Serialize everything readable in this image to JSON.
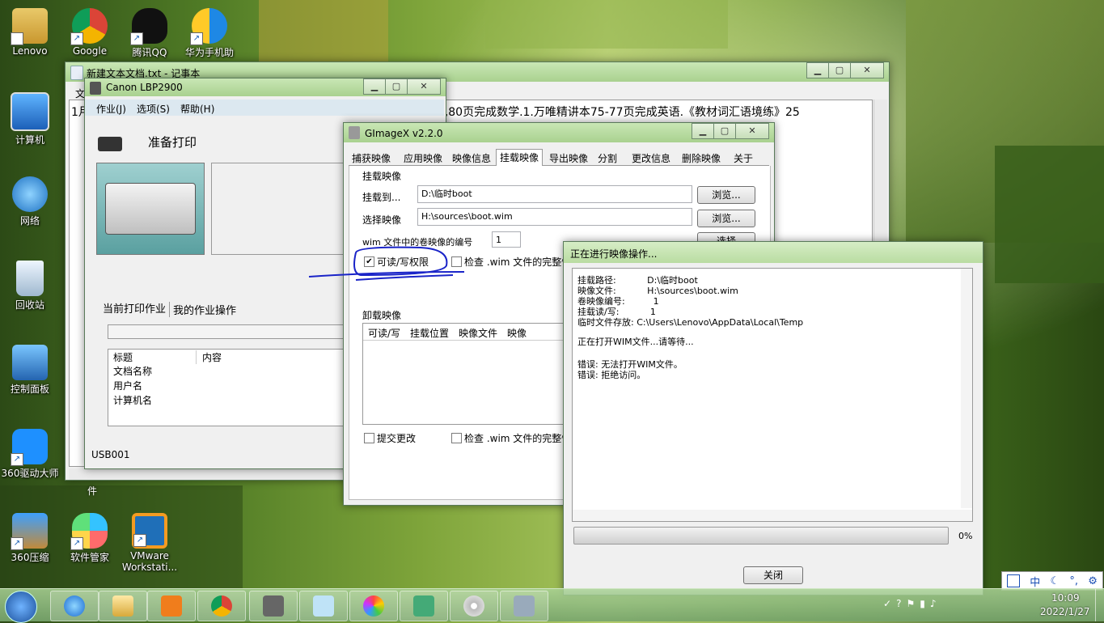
{
  "desktop": {
    "icons": [
      {
        "label": "Lenovo"
      },
      {
        "label": "Google"
      },
      {
        "label": "腾讯QQ"
      },
      {
        "label": "华为手机助"
      },
      {
        "label": "计算机"
      },
      {
        "label": "网络"
      },
      {
        "label": "回收站"
      },
      {
        "label": "控制面板"
      },
      {
        "label": "360驱动大师"
      },
      {
        "label": "360压缩"
      },
      {
        "label": "软件管家"
      },
      {
        "label": "VMware Workstati..."
      }
    ],
    "partial_label": "件"
  },
  "notepad": {
    "title": "新建文本文档.txt - 记事本",
    "menu_partial": "文",
    "line_left": "1月",
    "line_right": "集77,80页完成数学.1.万唯精讲本75-77页完成英语.《教材词汇语境练》25"
  },
  "printer": {
    "title": "Canon LBP2900",
    "menu": [
      "作业(J)",
      "选项(S)",
      "帮助(H)"
    ],
    "status": "准备打印",
    "tabs": [
      "当前打印作业",
      "我的作业操作"
    ],
    "columns": [
      "标题",
      "内容"
    ],
    "rows": [
      "文档名称",
      "用户名",
      "计算机名"
    ],
    "port": "USB001"
  },
  "gimagex": {
    "title": "GImageX v2.2.0",
    "tabs": [
      "捕获映像",
      "应用映像",
      "映像信息",
      "挂载映像",
      "导出映像",
      "分割",
      "更改信息",
      "删除映像",
      "关于"
    ],
    "mount_group": "挂载映像",
    "mount_to_label": "挂载到...",
    "mount_to_value": "D:\\临时boot",
    "select_image_label": "选择映像",
    "select_image_value": "H:\\sources\\boot.wim",
    "browse": "浏览...",
    "volume_label": "wim 文件中的卷映像的编号",
    "volume_value": "1",
    "select_btn": "选择",
    "rw_label": "可读/写权限",
    "rw_checked": true,
    "verify_label": "检查 .wim 文件的完整性",
    "unmount_group": "卸载映像",
    "list_columns": [
      "可读/写",
      "挂载位置",
      "映像文件",
      "映像"
    ],
    "commit_label": "提交更改",
    "verify2_label": "检查 .wim 文件的完整性"
  },
  "progress": {
    "title": "正在进行映像操作...",
    "lines": [
      "挂载路径:           D:\\临时boot",
      "映像文件:           H:\\sources\\boot.wim",
      "卷映像编号:          1",
      "挂载读/写:           1",
      "临时文件存放: C:\\Users\\Lenovo\\AppData\\Local\\Temp"
    ],
    "waiting": "正在打开WIM文件...请等待...",
    "errors": [
      "错误: 无法打开WIM文件。",
      "错误: 拒绝访问。"
    ],
    "percent": "0%",
    "progress_value": 0,
    "close_btn": "关闭"
  },
  "ime": {
    "items": [
      "中",
      "☾",
      "°,",
      "⚙"
    ]
  },
  "tray": {
    "time": "10:09",
    "date": "2022/1/27"
  },
  "colors": {
    "annotation": "#1a24c8",
    "accent_green": "#a9d18f"
  }
}
